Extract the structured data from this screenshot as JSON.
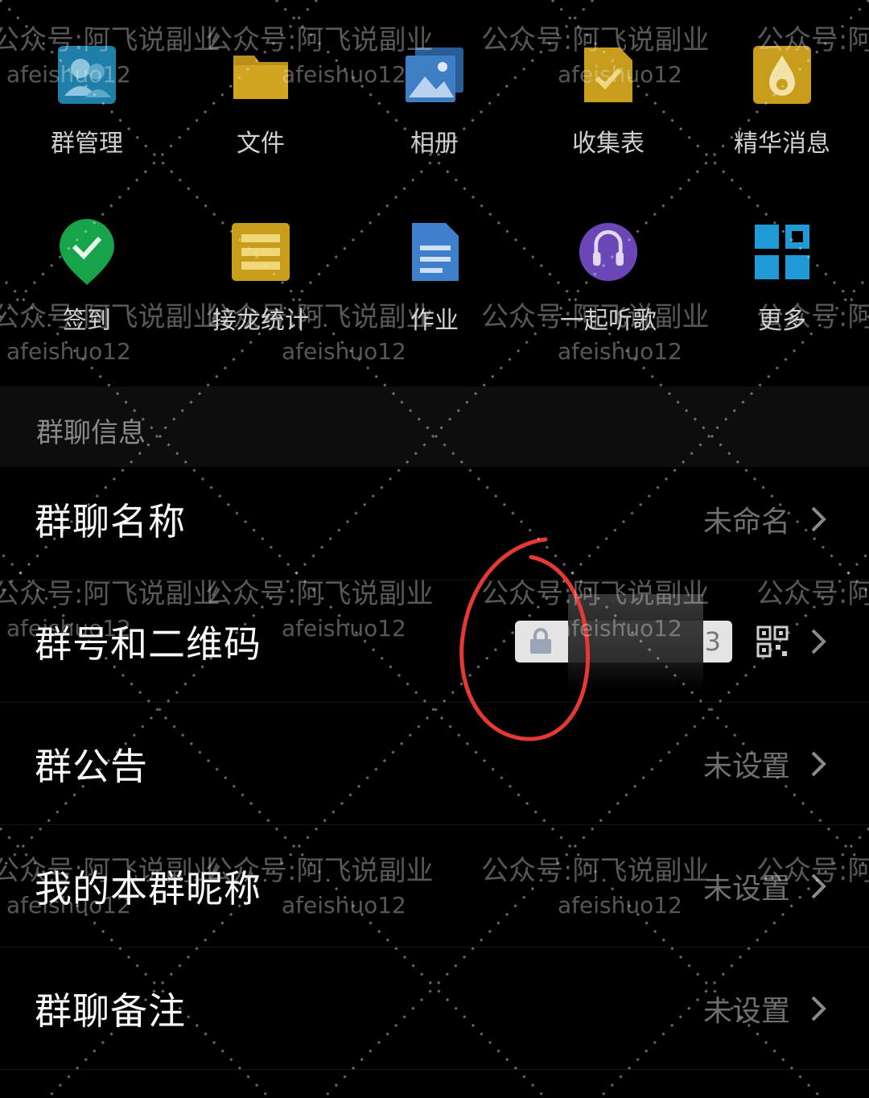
{
  "grid": {
    "row1": [
      {
        "label": "群管理",
        "icon": "group-manage-icon"
      },
      {
        "label": "文件",
        "icon": "folder-icon"
      },
      {
        "label": "相册",
        "icon": "album-icon"
      },
      {
        "label": "收集表",
        "icon": "collection-form-icon"
      },
      {
        "label": "精华消息",
        "icon": "essence-message-icon"
      }
    ],
    "row2": [
      {
        "label": "签到",
        "icon": "check-in-icon"
      },
      {
        "label": "接龙统计",
        "icon": "relay-stats-icon"
      },
      {
        "label": "作业",
        "icon": "homework-icon"
      },
      {
        "label": "一起听歌",
        "icon": "listen-together-icon"
      },
      {
        "label": "更多",
        "icon": "more-apps-icon"
      }
    ]
  },
  "section": {
    "title": "群聊信息"
  },
  "rows": {
    "name": {
      "label": "群聊名称",
      "value": "未命名"
    },
    "qrcode": {
      "label": "群号和二维码",
      "value_end": "3"
    },
    "notice": {
      "label": "群公告",
      "value": "未设置"
    },
    "nickname": {
      "label": "我的本群昵称",
      "value": "未设置"
    },
    "remark": {
      "label": "群聊备注",
      "value": "未设置"
    }
  },
  "watermark": {
    "line1": "公众号:阿飞说副业",
    "line2": "afeishuo12"
  },
  "colors": {
    "background": "#000000",
    "annotation_circle": "#e53935"
  }
}
